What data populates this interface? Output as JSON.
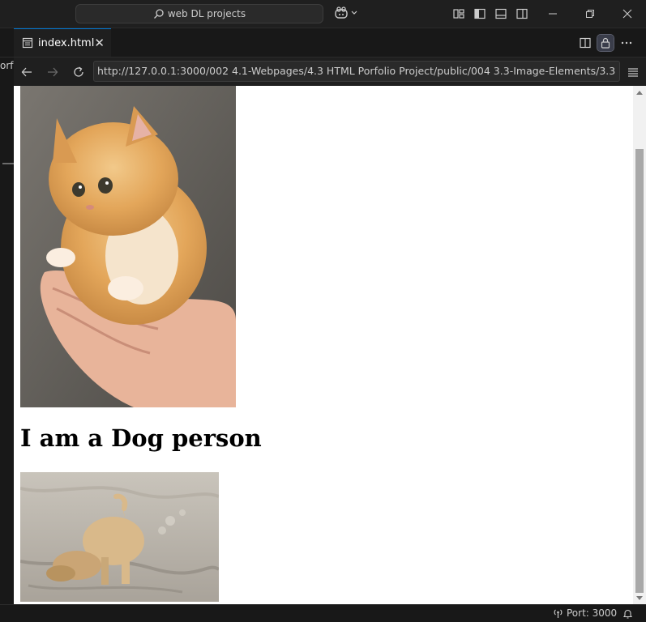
{
  "titlebar": {
    "search_text": "web DL projects"
  },
  "tab": {
    "label": "index.html"
  },
  "sidebar": {
    "partial_text": "orf"
  },
  "browser": {
    "url": "http://127.0.0.1:3000/002 4.1-Webpages/4.3 HTML Porfolio Project/public/004 3.3-Image-Elements/3.3 Image"
  },
  "page": {
    "heading": "I am a Dog person"
  },
  "statusbar": {
    "port": "Port: 3000"
  },
  "colors": {
    "accent": "#0078d4",
    "background": "#1f1f1f",
    "viewport": "#ffffff"
  },
  "icons": [
    "search-icon",
    "copilot-icon",
    "layout-icon",
    "sidebar-toggle-icon",
    "panel-toggle-icon",
    "secondary-sidebar-icon",
    "minimize-icon",
    "restore-icon",
    "close-icon",
    "preview-icon",
    "split-editor-icon",
    "lock-icon",
    "more-icon",
    "back-icon",
    "forward-icon",
    "reload-icon",
    "menu-icon",
    "broadcast-icon",
    "bell-icon"
  ]
}
